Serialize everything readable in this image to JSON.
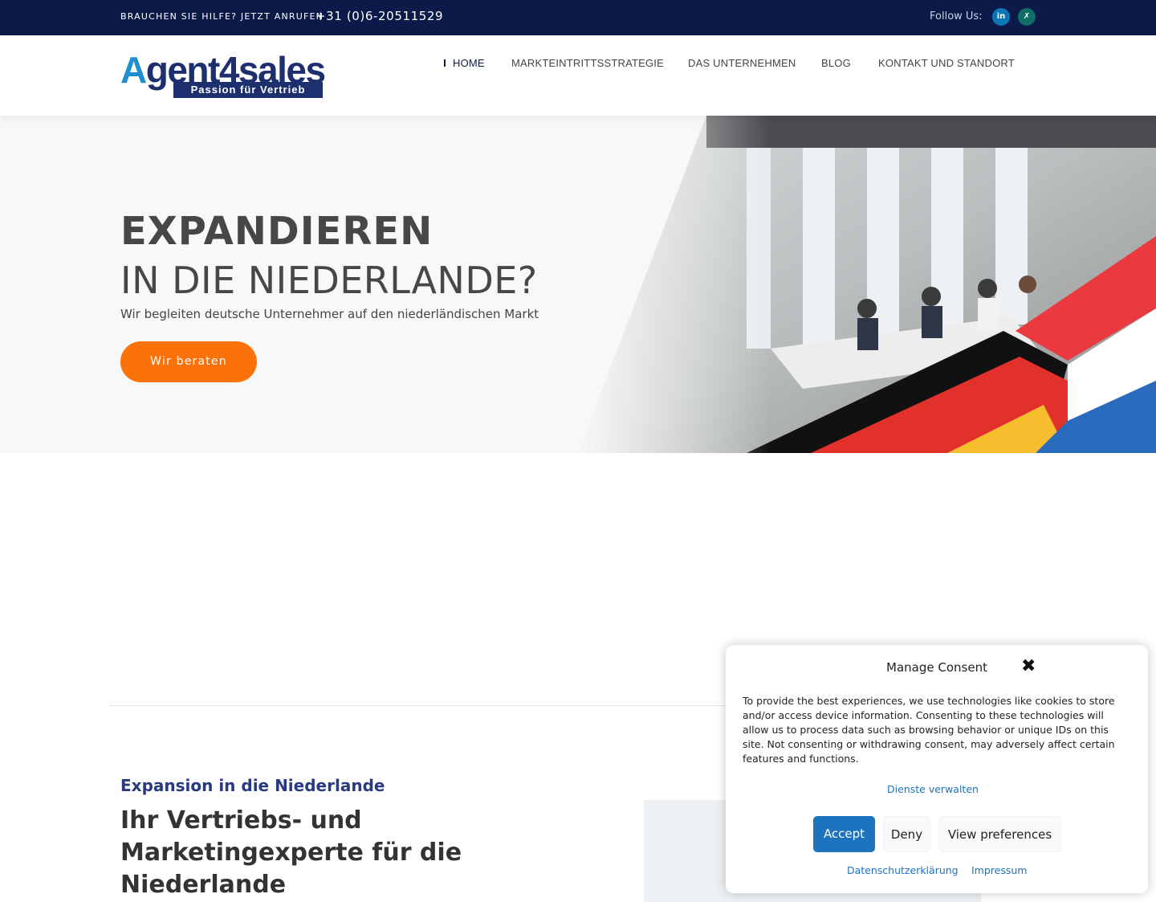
{
  "topbar": {
    "help_text": "BRAUCHEN SIE HILFE? JETZT ANRUFEN",
    "phone": "+31 (0)6-20511529",
    "follow_label": "Follow Us:",
    "social": [
      {
        "icon": "linkedin-icon",
        "glyph": "in"
      },
      {
        "icon": "xing-icon",
        "glyph": "✗"
      }
    ]
  },
  "header": {
    "logo_text_a": "A",
    "logo_text_rest": "gent4sales",
    "logo_tagline": "Passion für Vertrieb",
    "nav": [
      "HOME",
      "MARKTEINTRITTSSTRATEGIE",
      "DAS UNTERNEHMEN",
      "BLOG",
      "KONTAKT UND STANDORT"
    ]
  },
  "hero": {
    "title_line1": "EXPANDIEREN",
    "title_line2": "IN DIE NIEDERLANDE?",
    "subtitle": "Wir begleiten deutsche Unternehmer auf den niederländischen Markt",
    "cta": "Wir beraten"
  },
  "section": {
    "kicker": "Expansion in die Niederlande",
    "title": "Ihr Vertriebs- und Marketingexperte für die Niederlande"
  },
  "consent": {
    "title": "Manage Consent",
    "body": "To provide the best experiences, we use technologies like cookies to store and/or access device information. Consenting to these technologies will allow us to process data such as browsing behavior or unique IDs on this site. Not consenting or withdrawing consent, may adversely affect certain features and functions.",
    "manage_services": "Dienste verwalten",
    "accept": "Accept",
    "deny": "Deny",
    "view_preferences": "View preferences",
    "privacy": "Datenschutzerklärung",
    "imprint": "Impressum"
  },
  "colors": {
    "topbar": "#0c1a4a",
    "accent_orange": "#fb7209",
    "consent_blue": "#1e73be",
    "kicker_blue": "#273a80"
  }
}
